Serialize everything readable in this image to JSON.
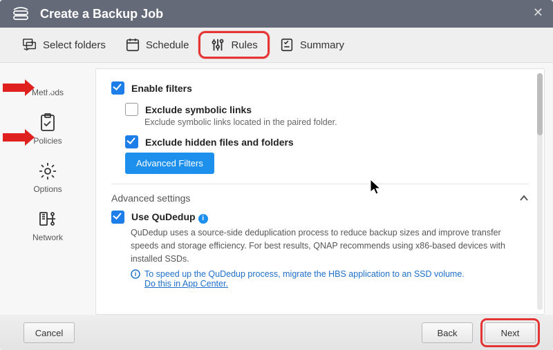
{
  "title": "Create a Backup Job",
  "tabs": {
    "folders": "Select folders",
    "schedule": "Schedule",
    "rules": "Rules",
    "summary": "Summary"
  },
  "sidebar": {
    "methods": "Methods",
    "policies": "Policies",
    "options": "Options",
    "network": "Network"
  },
  "filters": {
    "enable": "Enable filters",
    "exclude_symlinks": "Exclude symbolic links",
    "exclude_symlinks_desc": "Exclude symbolic links located in the paired folder.",
    "exclude_hidden": "Exclude hidden files and folders",
    "advanced_btn": "Advanced Filters"
  },
  "advanced": {
    "header": "Advanced settings",
    "qudedup": "Use QuDedup",
    "qudedup_desc": "QuDedup uses a source-side deduplication process to reduce backup sizes and improve transfer speeds and storage efficiency. For best results, QNAP recommends using x86-based devices with installed SSDs.",
    "qudedup_tip": "To speed up the QuDedup process, migrate the HBS application to an SSD volume.",
    "qudedup_link": "Do this in App Center."
  },
  "footer": {
    "cancel": "Cancel",
    "back": "Back",
    "next": "Next"
  },
  "colors": {
    "accent": "#1d7eea",
    "highlight": "#e53434"
  }
}
